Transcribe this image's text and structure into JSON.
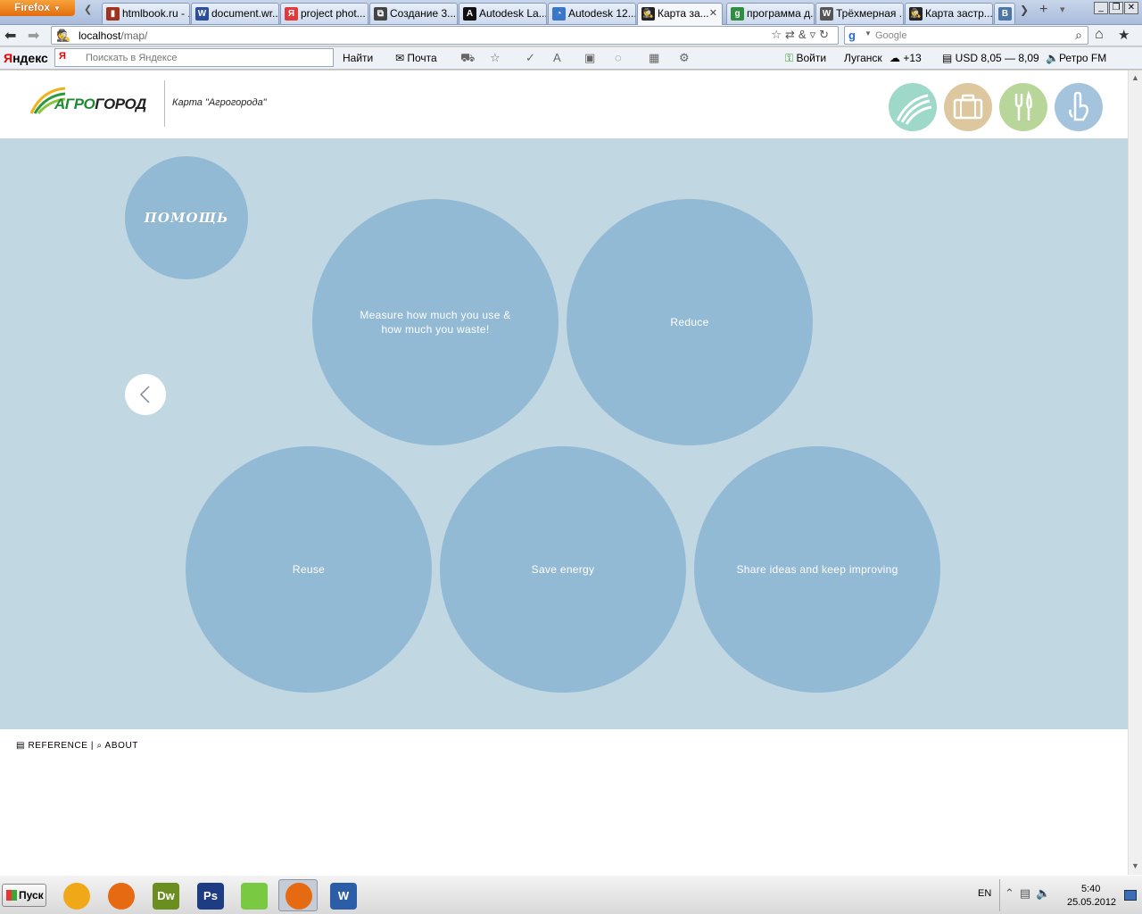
{
  "browser": {
    "menu_button": "Firefox",
    "tabs": [
      {
        "title": "htmlbook.ru - ...",
        "icon": "htmlbook-icon",
        "color": "#a0331f"
      },
      {
        "title": "document.wr...",
        "icon": "w-icon",
        "color": "#2b4d9a"
      },
      {
        "title": "project phot...",
        "icon": "yandex-icon",
        "color": "#e03a3a"
      },
      {
        "title": "Создание 3...",
        "icon": "page-icon",
        "color": "#444444"
      },
      {
        "title": "Autodesk La...",
        "icon": "autodesk-icon",
        "color": "#111111"
      },
      {
        "title": "Autodesk 12...",
        "icon": "autodesk-blue-icon",
        "color": "#3b77c9"
      },
      {
        "title": "Карта за...",
        "icon": "incognito-icon",
        "color": "#222222",
        "active": true
      },
      {
        "title": "программа д...",
        "icon": "google-icon",
        "color": "#2f8f3f"
      },
      {
        "title": "Трёхмерная ...",
        "icon": "wikipedia-icon",
        "color": "#555555"
      },
      {
        "title": "Карта застр...",
        "icon": "incognito-icon",
        "color": "#222222"
      },
      {
        "title": "",
        "icon": "vk-icon",
        "color": "#4a76a8"
      }
    ],
    "url_host": "localhost",
    "url_path": "/map/",
    "search_placeholder": "Google"
  },
  "yandex_bar": {
    "logo_letter": "Я",
    "logo_rest": "ндекс",
    "search_icon_letter": "Я",
    "search_placeholder": "Поискать в Яндексе",
    "find_button": "Найти",
    "mail": "Почта",
    "login": "Войти",
    "city": "Луганск",
    "weather": "+13",
    "currency": "USD 8,05 — 8,09",
    "radio": "Ретро FM"
  },
  "page": {
    "logo_accent": "АГРО",
    "logo_rest": "ГОРОД",
    "site_title": "Карта \"Агрогорода\"",
    "nav_icons": [
      {
        "name": "fields-icon",
        "color": "#9dd8c8"
      },
      {
        "name": "briefcase-icon",
        "color": "#dcc79e"
      },
      {
        "name": "restaurant-icon",
        "color": "#b8d699"
      },
      {
        "name": "hand-icon",
        "color": "#a4c4dd"
      }
    ],
    "help_label": "ПОМОЩЬ",
    "bubbles": [
      "Measure how much you use & how much you waste!",
      "Reduce",
      "Reuse",
      "Save energy",
      "Share ideas and keep improving"
    ],
    "footer": {
      "reference": "REFERENCE",
      "separator": "|",
      "about": "ABOUT"
    },
    "colors": {
      "map_background": "#c1d7e2",
      "bubble": "#93bad5"
    }
  },
  "taskbar": {
    "start": "Пуск",
    "apps": [
      {
        "name": "aimp-icon",
        "label": "",
        "color": "#f0a818"
      },
      {
        "name": "firefox-icon",
        "label": "",
        "color": "#e66a12"
      },
      {
        "name": "dreamweaver-icon",
        "label": "Dw",
        "color": "#6a8e20"
      },
      {
        "name": "photoshop-icon",
        "label": "Ps",
        "color": "#1d3c84"
      },
      {
        "name": "gadget-icon",
        "label": "",
        "color": "#7ac943"
      },
      {
        "name": "firefox-active-icon",
        "label": "",
        "color": "#e66a12"
      },
      {
        "name": "word-icon",
        "label": "W",
        "color": "#2c5ea8"
      }
    ],
    "language": "EN",
    "time": "5:40",
    "date": "25.05.2012"
  }
}
